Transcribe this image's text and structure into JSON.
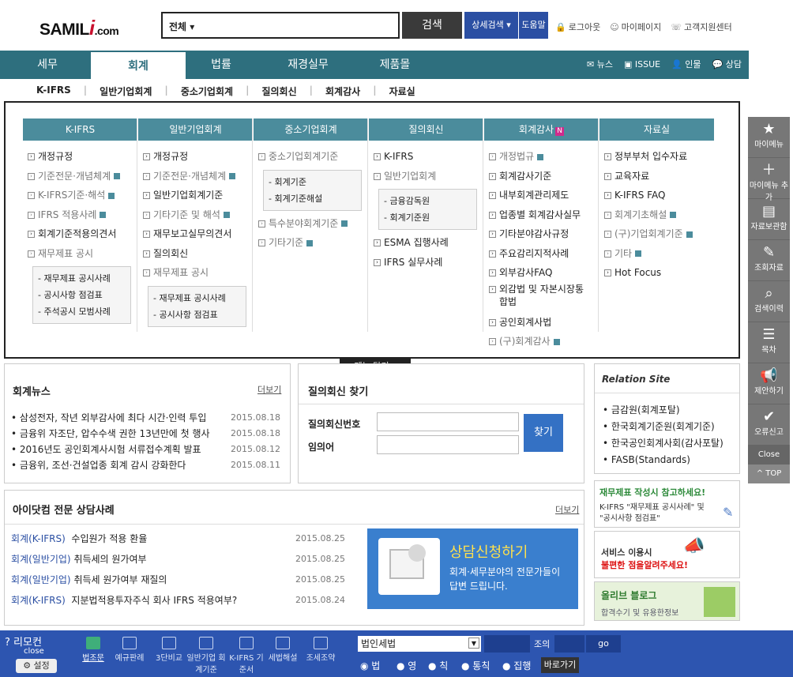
{
  "logo": {
    "samil": "SAMIL",
    "i": "i",
    "com": ".com"
  },
  "search": {
    "scope": "전체",
    "button": "검색",
    "advanced": "상세검색",
    "help": "도움말"
  },
  "toplinks": [
    "로그아웃",
    "마이페이지",
    "고객지원센터"
  ],
  "nav": {
    "tabs": [
      "세무",
      "회계",
      "법률",
      "재경실무",
      "제품몰"
    ],
    "active": "회계",
    "right": [
      "뉴스",
      "ISSUE",
      "인물",
      "상담"
    ]
  },
  "subnav": [
    "K-IFRS",
    "일반기업회계",
    "중소기업회계",
    "질의회신",
    "회계감사",
    "자료실"
  ],
  "menu": {
    "columns": [
      {
        "title": "K-IFRS",
        "items": [
          "개정규정",
          "기준전문·개념체계",
          "K-IFRS기준·해석",
          "IFRS 적용사례",
          "회계기준적용의견서",
          "재무제표 공시"
        ],
        "box": [
          "- 재무제표 공시사례",
          "- 공시사항 점검표",
          "- 주석공시 모범사례"
        ]
      },
      {
        "title": "일반기업회계",
        "items": [
          "개정규정",
          "기준전문·개념체계",
          "일반기업회계기준",
          "기타기준 및 해석",
          "재무보고실무의견서",
          "질의회신",
          "재무제표 공시"
        ],
        "box": [
          "- 재무제표 공시사례",
          "- 공시사항 점검표"
        ]
      },
      {
        "title": "중소기업회계",
        "items": [
          "중소기업회계기준"
        ],
        "box": [
          "- 회계기준",
          "- 회계기준해설"
        ],
        "items2": [
          "특수분야회계기준",
          "기타기준"
        ]
      },
      {
        "title": "질의회신",
        "items": [
          "K-IFRS",
          "일반기업회계"
        ],
        "box": [
          "- 금융감독원",
          "- 회계기준원"
        ],
        "items2": [
          "ESMA 집행사례",
          "IFRS 실무사례"
        ]
      },
      {
        "title": "회계감사",
        "badge": "N",
        "items": [
          "개정법규",
          "회계감사기준",
          "내부회계관리제도",
          "업종별 회계감사실무",
          "기타분야감사규정",
          "주요감리지적사례",
          "외부감사FAQ",
          "외감법 및 자본시장통",
          "합법",
          "공인회계사법",
          "(구)회계감사"
        ]
      },
      {
        "title": "자료실",
        "items": [
          "정부부처 입수자료",
          "교육자료",
          "K-IFRS FAQ",
          "회계기초해설",
          "(구)기업회계기준",
          "기타",
          "Hot Focus"
        ]
      }
    ],
    "close": "메뉴 닫기"
  },
  "news": {
    "title": "회계뉴스",
    "more": "더보기",
    "items": [
      {
        "t": "삼성전자, 작년 외부감사에 최다 시간·인력 투입",
        "d": "2015.08.18"
      },
      {
        "t": "금융위 자조단, 압수수색 권한 13년만에 첫 행사",
        "d": "2015.08.18"
      },
      {
        "t": "2016년도 공인회계사시험 서류접수계획 발표",
        "d": "2015.08.12"
      },
      {
        "t": "금융위, 조선·건설업종 회계 감시 강화한다",
        "d": "2015.08.11"
      }
    ]
  },
  "qsearch": {
    "title": "질의회신 찾기",
    "no": "질의회신번호",
    "term": "임의어",
    "btn": "찾기"
  },
  "relation": {
    "title": "Relation Site",
    "items": [
      "금감원(회계포탈)",
      "한국회계기준원(회계기준)",
      "한국공인회계사회(감사포탈)",
      "FASB(Standards)"
    ]
  },
  "consult": {
    "title": "아이닷컴 전문 상담사례",
    "more": "더보기",
    "items": [
      {
        "c": "회계(K-IFRS)",
        "t": "수입원가 적용 환율",
        "d": "2015.08.25"
      },
      {
        "c": "회계(일반기업)",
        "t": "취득세의 원가여부",
        "d": "2015.08.25"
      },
      {
        "c": "회계(일반기업)",
        "t": "취득세 원가여부 재질의",
        "d": "2015.08.25"
      },
      {
        "c": "회계(K-IFRS)",
        "t": "지분법적용투자주식 회사 IFRS 적용여부?",
        "d": "2015.08.24"
      }
    ]
  },
  "banner": {
    "title": "상담신청하기",
    "line1": "회계·세무분야의 전문가들이",
    "line2": "답변 드립니다."
  },
  "ads": {
    "a1": {
      "title": "재무제표 작성시 참고하세요!",
      "line1": "K-IFRS \"재무제표 공시사례\" 및",
      "line2": "\"공시사항 점검표\""
    },
    "a2": {
      "line1": "서비스 이용시",
      "line2": "불편한 점을알려주세요!"
    },
    "a3": {
      "title": "올리브 블로그",
      "sub": "합격수기 및 유용한정보"
    }
  },
  "sidebar": {
    "items": [
      "마이메뉴",
      "마이메뉴 추가",
      "자료보관함",
      "조회자료",
      "검색이력",
      "목차",
      "제안하기",
      "오류신고"
    ],
    "close": "Close",
    "top": "TOP"
  },
  "bottom": {
    "remocon": "리모컨",
    "close": "close",
    "settings": "설정",
    "tools": [
      "법조문",
      "예규판례",
      "3단비교",
      "일반기업 회계기준",
      "K-IFRS 기준서",
      "세법해설",
      "조세조약"
    ],
    "select": "법인세법",
    "jo": "조의",
    "go": "go",
    "radios": [
      "법",
      "영",
      "칙",
      "통칙",
      "집행"
    ],
    "goto": "바로가기"
  },
  "colors": {
    "nav": "#2e6f7e",
    "header": "#4b8c9c",
    "bottom": "#2d55b0",
    "accent": "#c8102e"
  }
}
